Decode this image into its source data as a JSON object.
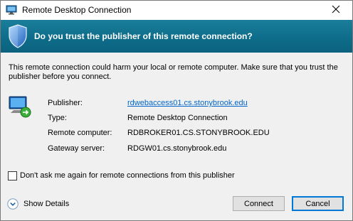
{
  "window": {
    "title": "Remote Desktop Connection"
  },
  "banner": {
    "question": "Do you trust the publisher of this remote connection?"
  },
  "warning": "This remote connection could harm your local or remote computer. Make sure that you trust the publisher before you connect.",
  "details": {
    "publisher_label": "Publisher:",
    "publisher_value": "rdwebaccess01.cs.stonybrook.edu",
    "type_label": "Type:",
    "type_value": "Remote Desktop Connection",
    "remote_label": "Remote computer:",
    "remote_value": "RDBROKER01.CS.STONYBROOK.EDU",
    "gateway_label": "Gateway server:",
    "gateway_value": "RDGW01.cs.stonybrook.edu"
  },
  "checkbox": {
    "label": "Don't ask me again for remote connections from this publisher",
    "checked": false
  },
  "show_details": "Show Details",
  "buttons": {
    "connect": "Connect",
    "cancel": "Cancel"
  },
  "icons": {
    "app": "remote-desktop-icon",
    "close": "close-icon",
    "banner": "shield-icon",
    "computer": "remote-computer-icon",
    "expand": "chevron-down-icon"
  },
  "colors": {
    "banner": "#0e6d8a",
    "link": "#0066cc",
    "focus": "#0078d7"
  }
}
